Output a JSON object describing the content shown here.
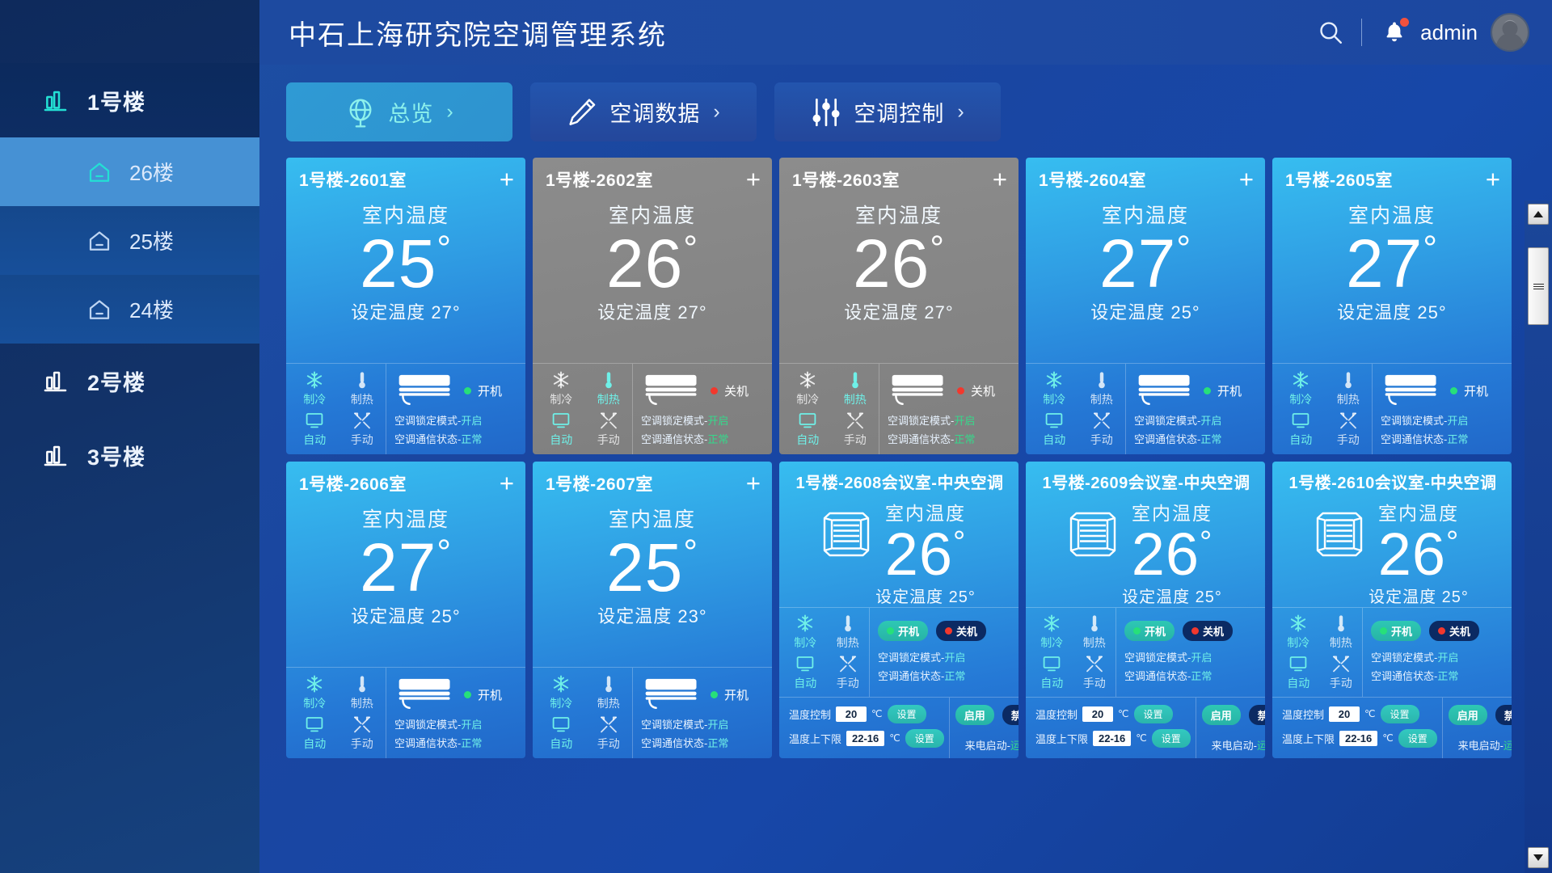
{
  "header": {
    "title": "中石上海研究院空调管理系统",
    "search_icon": "search-icon",
    "bell_icon": "bell-icon",
    "username": "admin"
  },
  "sidebar": {
    "buildings": [
      {
        "label": "1号楼",
        "active": true,
        "floors": [
          {
            "label": "26楼",
            "selected": true
          },
          {
            "label": "25楼",
            "selected": false
          },
          {
            "label": "24楼",
            "selected": false
          }
        ]
      },
      {
        "label": "2号楼",
        "active": false,
        "floors": []
      },
      {
        "label": "3号楼",
        "active": false,
        "floors": []
      }
    ]
  },
  "tabs": [
    {
      "label": "总览",
      "icon": "globe-icon",
      "chevron": "›",
      "active": true
    },
    {
      "label": "空调数据",
      "icon": "pencil-icon",
      "chevron": "›",
      "active": false
    },
    {
      "label": "空调控制",
      "icon": "sliders-icon",
      "chevron": "›",
      "active": false
    }
  ],
  "labels": {
    "indoor_temp": "室内温度",
    "set_temp_prefix": "设定温度",
    "degree": "°",
    "mode_cool": "制冷",
    "mode_heat": "制热",
    "mode_auto": "自动",
    "mode_manual": "手动",
    "lock_mode": "空调锁定模式-",
    "comm_state": "空调通信状态-",
    "power_on": "开机",
    "power_off": "关机",
    "temp_control": "温度控制",
    "temp_limit": "温度上下限",
    "unit_c": "℃",
    "btn_set": "设置",
    "btn_enable": "启用",
    "btn_disable": "禁用",
    "boot_on_power": "来电启动-",
    "plus": "+"
  },
  "colors": {
    "accent_cyan": "#6ff0e8",
    "status_green": "#35d98b",
    "dot_green": "#27e07a",
    "dot_red": "#f2382d",
    "card_on": "#37bdf0",
    "card_off": "#8c8c8c",
    "brand_blue": "#1d4aa0"
  },
  "cards": [
    {
      "title": "1号楼-2601室",
      "type": "room",
      "state": "on",
      "indoor": "25",
      "set": "27",
      "modes": {
        "cool": true,
        "heat": false,
        "auto": true,
        "manual": false
      },
      "power": "开机",
      "power_state": "on",
      "lock_value": "开启",
      "comm_value": "正常"
    },
    {
      "title": "1号楼-2602室",
      "type": "room",
      "state": "off",
      "indoor": "26",
      "set": "27",
      "modes": {
        "cool": false,
        "heat": true,
        "auto": true,
        "manual": false
      },
      "power": "关机",
      "power_state": "off",
      "lock_value": "开启",
      "comm_value": "正常"
    },
    {
      "title": "1号楼-2603室",
      "type": "room",
      "state": "off",
      "indoor": "26",
      "set": "27",
      "modes": {
        "cool": false,
        "heat": true,
        "auto": true,
        "manual": false
      },
      "power": "关机",
      "power_state": "off",
      "lock_value": "开启",
      "comm_value": "正常"
    },
    {
      "title": "1号楼-2604室",
      "type": "room",
      "state": "on",
      "indoor": "27",
      "set": "25",
      "modes": {
        "cool": true,
        "heat": false,
        "auto": true,
        "manual": false
      },
      "power": "开机",
      "power_state": "on",
      "lock_value": "开启",
      "comm_value": "正常"
    },
    {
      "title": "1号楼-2605室",
      "type": "room",
      "state": "on",
      "indoor": "27",
      "set": "25",
      "modes": {
        "cool": true,
        "heat": false,
        "auto": true,
        "manual": false
      },
      "power": "开机",
      "power_state": "on",
      "lock_value": "开启",
      "comm_value": "正常"
    },
    {
      "title": "1号楼-2606室",
      "type": "room",
      "state": "on",
      "indoor": "27",
      "set": "25",
      "modes": {
        "cool": true,
        "heat": false,
        "auto": true,
        "manual": false
      },
      "power": "开机",
      "power_state": "on",
      "lock_value": "开启",
      "comm_value": "正常"
    },
    {
      "title": "1号楼-2607室",
      "type": "room",
      "state": "on",
      "indoor": "25",
      "set": "23",
      "modes": {
        "cool": true,
        "heat": false,
        "auto": true,
        "manual": false
      },
      "power": "开机",
      "power_state": "on",
      "lock_value": "开启",
      "comm_value": "正常"
    },
    {
      "title": "1号楼-2608会议室-中央空调",
      "type": "meeting",
      "state": "on",
      "indoor": "26",
      "set": "25",
      "modes": {
        "cool": true,
        "heat": false,
        "auto": true,
        "manual": false
      },
      "power_on_label": "开机",
      "power_off_label": "关机",
      "lock_value": "开启",
      "comm_value": "正常",
      "temp_control_value": "20",
      "temp_limit_value": "22-16",
      "boot_value": "运行"
    },
    {
      "title": "1号楼-2609会议室-中央空调",
      "type": "meeting",
      "state": "on",
      "indoor": "26",
      "set": "25",
      "modes": {
        "cool": true,
        "heat": false,
        "auto": true,
        "manual": false
      },
      "power_on_label": "开机",
      "power_off_label": "关机",
      "lock_value": "开启",
      "comm_value": "正常",
      "temp_control_value": "20",
      "temp_limit_value": "22-16",
      "boot_value": "运行"
    },
    {
      "title": "1号楼-2610会议室-中央空调",
      "type": "meeting",
      "state": "on",
      "indoor": "26",
      "set": "25",
      "modes": {
        "cool": true,
        "heat": false,
        "auto": true,
        "manual": false
      },
      "power_on_label": "开机",
      "power_off_label": "关机",
      "lock_value": "开启",
      "comm_value": "正常",
      "temp_control_value": "20",
      "temp_limit_value": "22-16",
      "boot_value": "运行"
    }
  ],
  "scrollbar": {
    "up": "▲",
    "down": "▼"
  }
}
